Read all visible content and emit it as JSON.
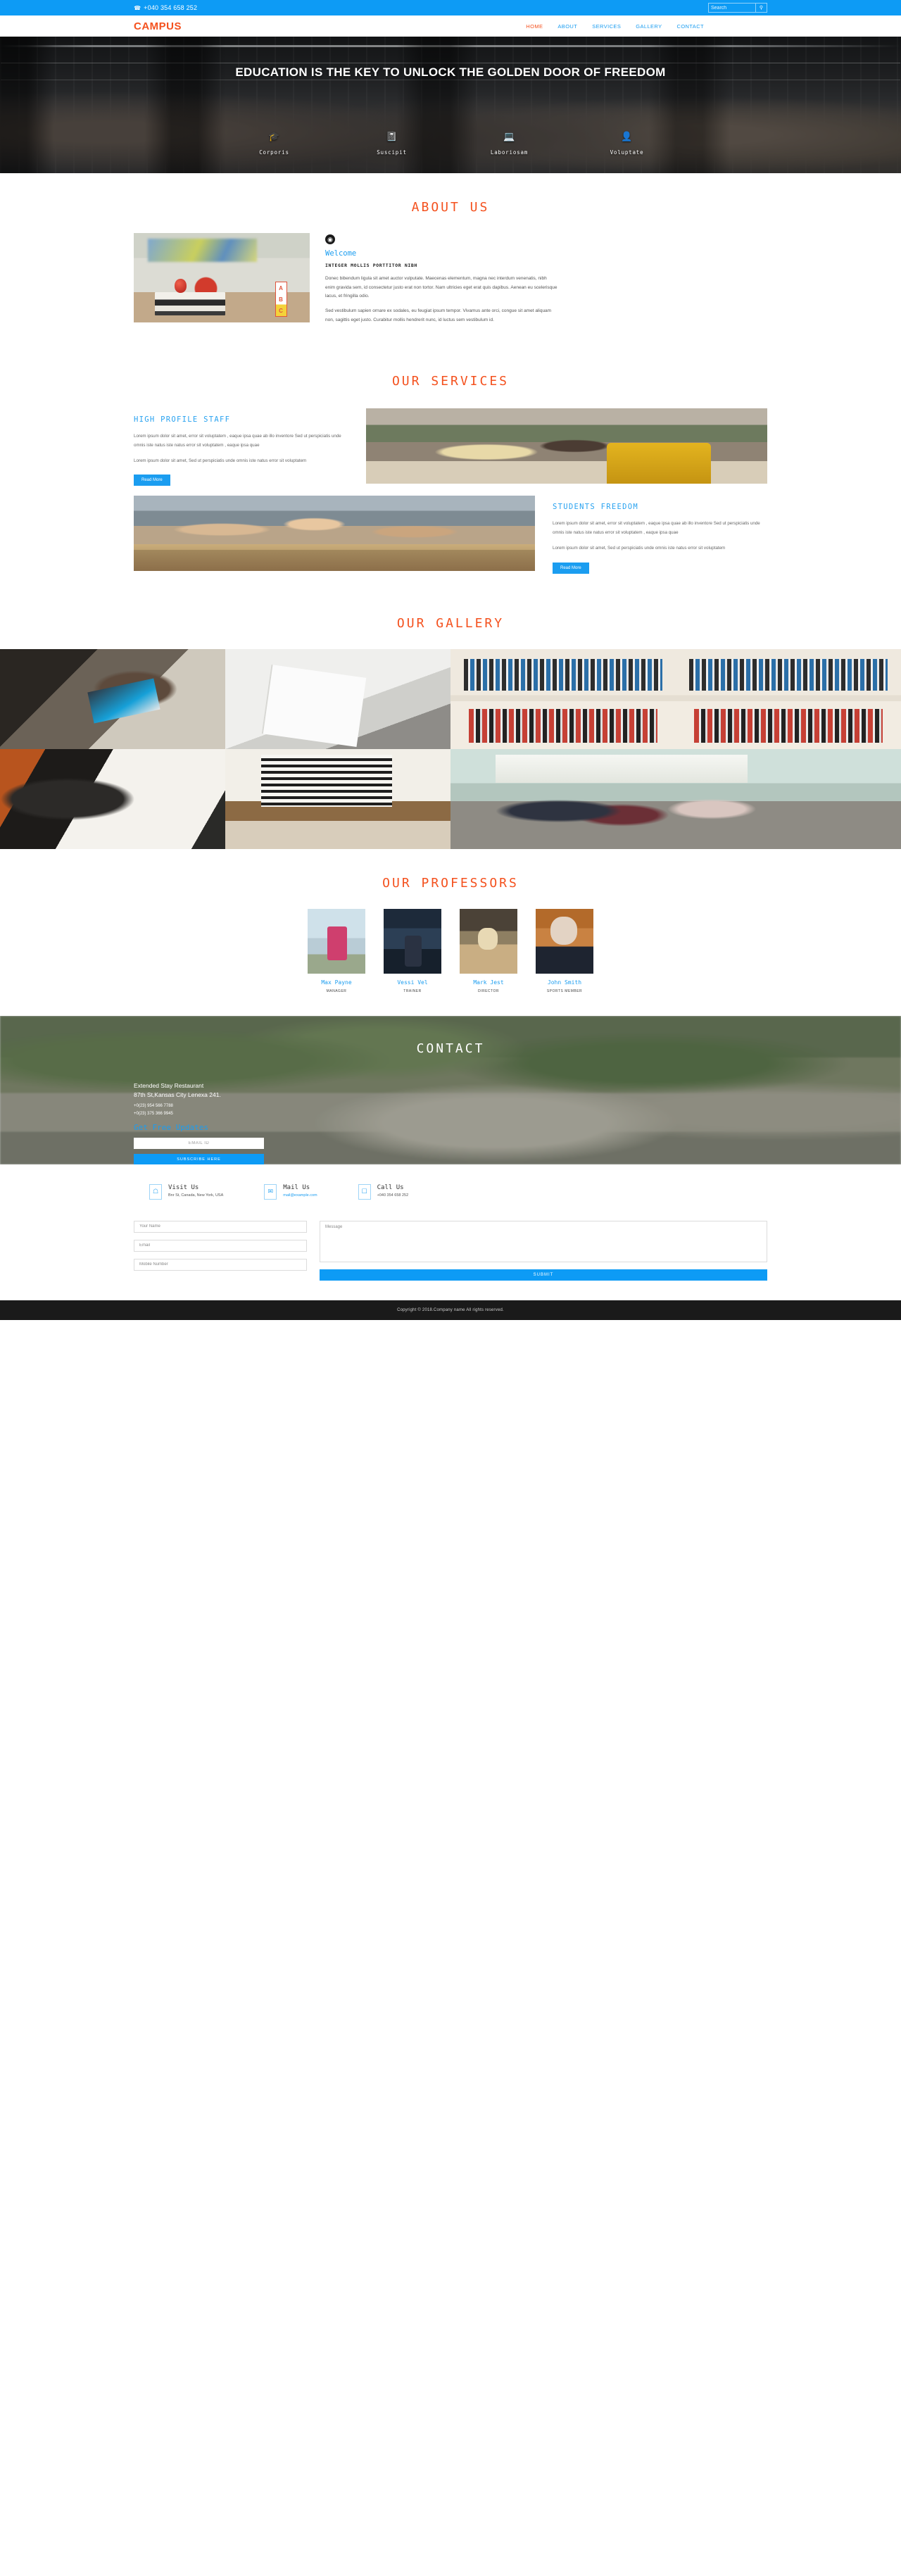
{
  "topbar": {
    "phone": "+040 354 658 252",
    "phone_icon": "phone-icon",
    "search_placeholder": "Search",
    "search_value": "",
    "search_icon": "search-icon"
  },
  "nav": {
    "logo": "CAMPUS",
    "items": [
      {
        "label": "HOME",
        "active": true
      },
      {
        "label": "ABOUT",
        "active": false
      },
      {
        "label": "SERVICES",
        "active": false
      },
      {
        "label": "GALLERY",
        "active": false
      },
      {
        "label": "CONTACT",
        "active": false
      }
    ]
  },
  "hero": {
    "title": "EDUCATION IS THE KEY TO UNLOCK THE GOLDEN DOOR OF FREEDOM",
    "features": [
      {
        "icon": "graduation-cap-icon",
        "glyph": "🎓",
        "label": "Corporis"
      },
      {
        "icon": "book-icon",
        "glyph": "📓",
        "label": "Suscipit"
      },
      {
        "icon": "laptop-icon",
        "glyph": "💻",
        "label": "Laboriosam"
      },
      {
        "icon": "user-icon",
        "glyph": "👤",
        "label": "Voluptate"
      }
    ]
  },
  "about": {
    "heading": "ABOUT US",
    "globe_icon": "globe-icon",
    "welcome": "Welcome",
    "subheading": "INTEGER MOLLIS PORTTITOR NIBH",
    "paragraph1": "Donec bibendum ligula sit amet auctor vulputate. Maecenas elementum, magna nec interdum venenatis, nibh enim gravida sem, id consectetur justo erat non tortor. Nam ultricies eget erat quis dapibus. Aenean eu scelerisque lacus, et fringilla odio.",
    "paragraph2": "Sed vestibulum sapien ornare ex sodales, eu feugiat ipsum tempor. Vivamus ante orci, congue sit amet aliquam non, sagittis eget justo. Curabitur mollis hendrerit nunc, id luctus sem vestibulum id.",
    "image_alt": "apple-on-books-photo"
  },
  "services": {
    "heading": "OUR SERVICES",
    "items": [
      {
        "title": "HIGH PROFILE STAFF",
        "paragraph1": "Lorem ipsum dolor sit amet, error sit voluptatem , eaque ipsa quae ab illo inventore Sed ut perspiciatis unde omnis iste natus iste natus error sit voluptatem , eaque ipsa quae",
        "paragraph2": "Lorem ipsum dolor sit amet, Sed ut perspiciatis unde omnis iste natus error sit voluptatem",
        "button": "Read More",
        "image_alt": "students-talking-photo"
      },
      {
        "title": "STUDENTS FREEDOM",
        "paragraph1": "Lorem ipsum dolor sit amet, error sit voluptatem , eaque ipsa quae ab illo inventore Sed ut perspiciatis unde omnis iste natus iste natus error sit voluptatem , eaque ipsa quae",
        "paragraph2": "Lorem ipsum dolor sit amet, Sed ut perspiciatis unde omnis iste natus error sit voluptatem",
        "button": "Read More",
        "image_alt": "students-group-project-photo"
      }
    ]
  },
  "gallery": {
    "heading": "OUR GALLERY",
    "images": [
      {
        "alt": "team-with-laptop-photo"
      },
      {
        "alt": "hand-writing-notebook-photo"
      },
      {
        "alt": "bookshelf-camera-photo"
      },
      {
        "alt": "planner-notes-89-percent-photo"
      },
      {
        "alt": "man-reading-book-photo"
      },
      {
        "alt": "classroom-students-photo"
      }
    ]
  },
  "professors": {
    "heading": "OUR PROFESSORS",
    "people": [
      {
        "name": "Max Payne",
        "role": "MANAGER",
        "photo_alt": "man-pink-shirt-photo"
      },
      {
        "name": "Vessi Vel",
        "role": "TRAINER",
        "photo_alt": "woman-night-city-photo"
      },
      {
        "name": "Mark Jest",
        "role": "DIRECTOR",
        "photo_alt": "woman-reading-book-photo"
      },
      {
        "name": "John Smith",
        "role": "SPORTS MEMBER",
        "photo_alt": "elderly-man-suit-photo"
      }
    ]
  },
  "contact": {
    "heading": "CONTACT",
    "address_line1": "Extended Stay Restaurant",
    "address_line2": "87th St,Kansas City Lenexa 241.",
    "phone1": "+0(23) 954 566 7788",
    "phone2": "+0(23) 375 366 9945",
    "updates_title": "Get Free Updates",
    "email_placeholder": "EMAIL ID",
    "email_value": "",
    "subscribe_button": "SUBSCRIBE HERE"
  },
  "footer": {
    "info_cards": [
      {
        "icon": "home-icon",
        "glyph": "🏠",
        "title": "Visit Us",
        "sub": "Bnr St, Canada, New York, USA",
        "is_link": false
      },
      {
        "icon": "envelope-icon",
        "glyph": "✉",
        "title": "Mail Us",
        "sub": "mail@example.com",
        "is_link": true
      },
      {
        "icon": "mobile-phone-icon",
        "glyph": "📱",
        "title": "Call Us",
        "sub": "+040 354 658 252",
        "is_link": false
      }
    ],
    "form": {
      "name_placeholder": "Your Name",
      "name_value": "",
      "email_placeholder": "Email",
      "email_value": "",
      "mobile_placeholder": "Mobile Number",
      "mobile_value": "",
      "message_placeholder": "Message",
      "message_value": "",
      "submit_button": "SUBMIT"
    },
    "copyright": "Copyright © 2018.Company name All rights reserved."
  },
  "colors": {
    "brand_blue": "#0d9bf5",
    "accent_orange": "#f4511e",
    "link_blue": "#1b9df0",
    "dark_footer": "#1a1a1a"
  }
}
